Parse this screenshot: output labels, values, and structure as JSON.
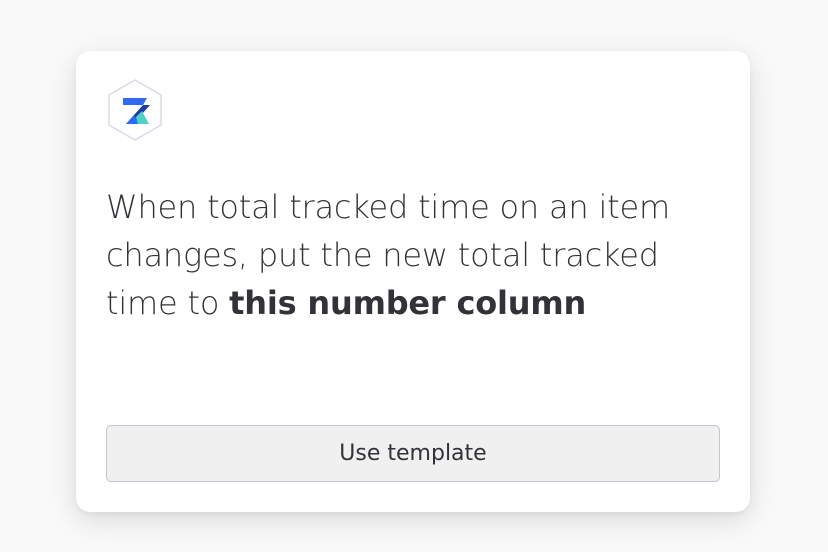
{
  "card": {
    "logo": {
      "icon": "app-hexagon-logo-icon",
      "colors": [
        "#2e6bf0",
        "#4fd1c5",
        "#1b3ea6"
      ]
    },
    "description": {
      "prefix": "When total tracked time on an item changes, put the new total tracked time to ",
      "emphasis": "this number column"
    },
    "button_label": "Use template"
  }
}
